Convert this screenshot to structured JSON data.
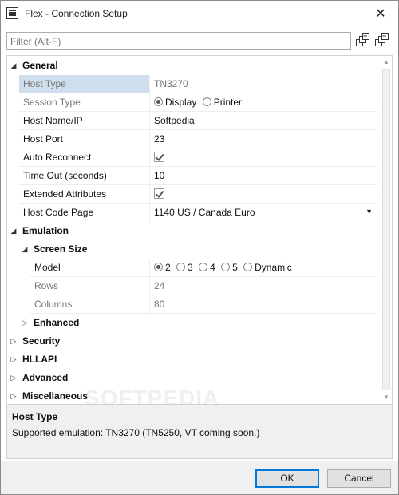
{
  "window": {
    "title": "Flex - Connection Setup",
    "close_glyph": "✕"
  },
  "filter": {
    "placeholder": "Filter (Alt-F)"
  },
  "toolbar": {
    "expand_icon": "expand-all-icon",
    "collapse_icon": "collapse-all-icon",
    "plus": "+",
    "minus": "−"
  },
  "grid": {
    "general": {
      "label": "General",
      "host_type": {
        "name": "Host Type",
        "value": "TN3270"
      },
      "session_type": {
        "name": "Session Type",
        "options": [
          "Display",
          "Printer"
        ],
        "selected": "Display"
      },
      "host_name": {
        "name": "Host Name/IP",
        "value": "Softpedia"
      },
      "host_port": {
        "name": "Host Port",
        "value": "23"
      },
      "auto_reconnect": {
        "name": "Auto Reconnect",
        "checked": true
      },
      "time_out": {
        "name": "Time Out (seconds)",
        "value": "10"
      },
      "extended_attributes": {
        "name": "Extended Attributes",
        "checked": true
      },
      "host_code_page": {
        "name": "Host Code Page",
        "value": "1140 US / Canada Euro"
      }
    },
    "emulation": {
      "label": "Emulation",
      "screen_size": {
        "label": "Screen Size",
        "model": {
          "name": "Model",
          "options": [
            "2",
            "3",
            "4",
            "5",
            "Dynamic"
          ],
          "selected": "2"
        },
        "rows": {
          "name": "Rows",
          "value": "24"
        },
        "columns": {
          "name": "Columns",
          "value": "80"
        }
      },
      "enhanced": {
        "label": "Enhanced"
      }
    },
    "security": {
      "label": "Security"
    },
    "hllapi": {
      "label": "HLLAPI"
    },
    "advanced": {
      "label": "Advanced"
    },
    "miscellaneous": {
      "label": "Miscellaneous"
    }
  },
  "description": {
    "title": "Host Type",
    "text": "Supported emulation: TN3270 (TN5250, VT coming soon.)"
  },
  "watermark": "SOFTPEDIA",
  "buttons": {
    "ok": "OK",
    "cancel": "Cancel"
  },
  "glyphs": {
    "expanded": "◢",
    "collapsed": "▷",
    "dropdown": "▼",
    "scroll_up": "▲",
    "scroll_down": "▼"
  }
}
